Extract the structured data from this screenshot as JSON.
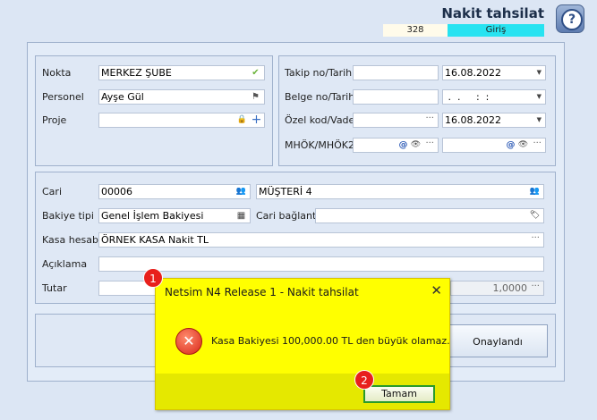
{
  "header": {
    "title": "Nakit tahsilat",
    "count": "328",
    "mode": "Giriş",
    "help_glyph": "?"
  },
  "left_panel": {
    "nokta_label": "Nokta",
    "nokta_value": "MERKEZ ŞUBE",
    "personel_label": "Personel",
    "personel_value": "Ayşe Gül",
    "proje_label": "Proje",
    "proje_value": ""
  },
  "right_panel": {
    "takip_label": "Takip no/Tarih",
    "takip_date": "16.08.2022",
    "belge_label": "Belge no/Tarih",
    "belge_date": " .  .     :  :",
    "ozel_label": "Özel kod/Vade",
    "ozel_date": "16.08.2022",
    "mhok_label": "MHÖK/MHÖK2"
  },
  "bottom_panel": {
    "cari_label": "Cari",
    "cari_code": "00006",
    "cari_name": "MÜŞTERİ 4",
    "bakiye_label": "Bakiye tipi",
    "bakiye_value": "Genel İşlem Bakiyesi",
    "cari_baglanti_label": "Cari bağlantı",
    "kasa_label": "Kasa hesabı",
    "kasa_value": "ÖRNEK KASA Nakit TL",
    "aciklama_label": "Açıklama",
    "tutar_label": "Tutar",
    "kur_value": "1,0000"
  },
  "actions": {
    "onay_label": "Onaylandı"
  },
  "dialog": {
    "title": "Netsim N4 Release 1 - Nakit tahsilat",
    "message": "Kasa Bakiyesi 100,000.00 TL den büyük olamaz.",
    "ok_label": "Tamam",
    "close_glyph": "✕",
    "error_glyph": "✕"
  },
  "badges": {
    "b1": "1",
    "b2": "2"
  },
  "icons": {
    "check": "✔",
    "pin": "⚑",
    "lock": "🔒",
    "plus": "+",
    "people": "👥",
    "calendar": "▦",
    "tag": "🏷",
    "at": "@",
    "eye": "👁",
    "ellipsis": "···",
    "dropdown": "▼"
  },
  "colors": {
    "mode_bg": "#27e3f1",
    "dialog_bg": "#ffff00",
    "badge": "#e8201c",
    "ok_border": "#2a9b2a"
  }
}
